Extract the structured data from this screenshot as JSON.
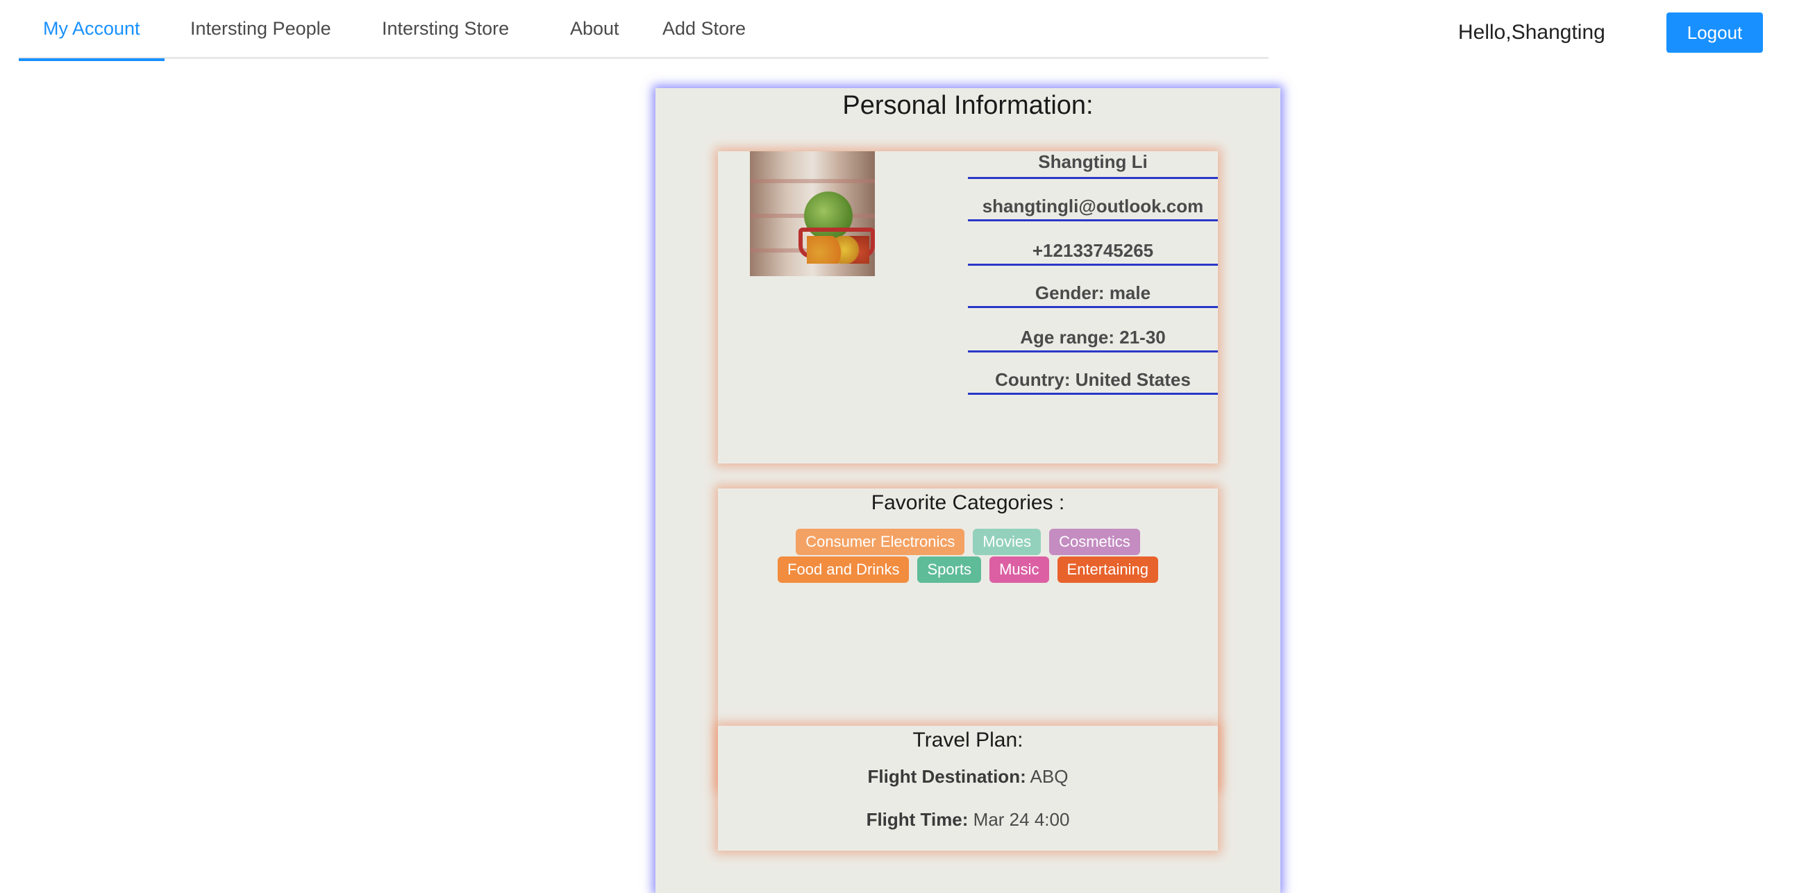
{
  "nav": {
    "tabs": [
      {
        "label": "My Account",
        "active": true
      },
      {
        "label": "Intersting People",
        "active": false
      },
      {
        "label": "Intersting Store",
        "active": false
      },
      {
        "label": "About",
        "active": false
      },
      {
        "label": "Add Store",
        "active": false
      }
    ],
    "greeting": "Hello,Shangting",
    "logout_label": "Logout"
  },
  "profile": {
    "title": "Personal Information:",
    "name": "Shangting Li",
    "email": "shangtingli@outlook.com",
    "phone": "+12133745265",
    "gender": "Gender: male",
    "age_range": "Age range: 21-30",
    "country": "Country: United States"
  },
  "categories": {
    "title": "Favorite Categories :",
    "tags": [
      {
        "label": "Consumer Electronics",
        "color": "#f4a263"
      },
      {
        "label": "Movies",
        "color": "#93d1bd"
      },
      {
        "label": "Cosmetics",
        "color": "#c48cc1"
      },
      {
        "label": "Food and Drinks",
        "color": "#f28c3f"
      },
      {
        "label": "Sports",
        "color": "#5fbc99"
      },
      {
        "label": "Music",
        "color": "#dc5fa3"
      },
      {
        "label": "Entertaining",
        "color": "#e8622b"
      }
    ]
  },
  "travel": {
    "title": "Travel Plan:",
    "destination_label": "Flight Destination:",
    "destination_value": "ABQ",
    "time_label": "Flight Time:",
    "time_value": "Mar 24 4:00"
  },
  "colors": {
    "accent": "#1890ff",
    "panel_bg": "#ebebe5",
    "field_underline": "#2a38c8"
  }
}
